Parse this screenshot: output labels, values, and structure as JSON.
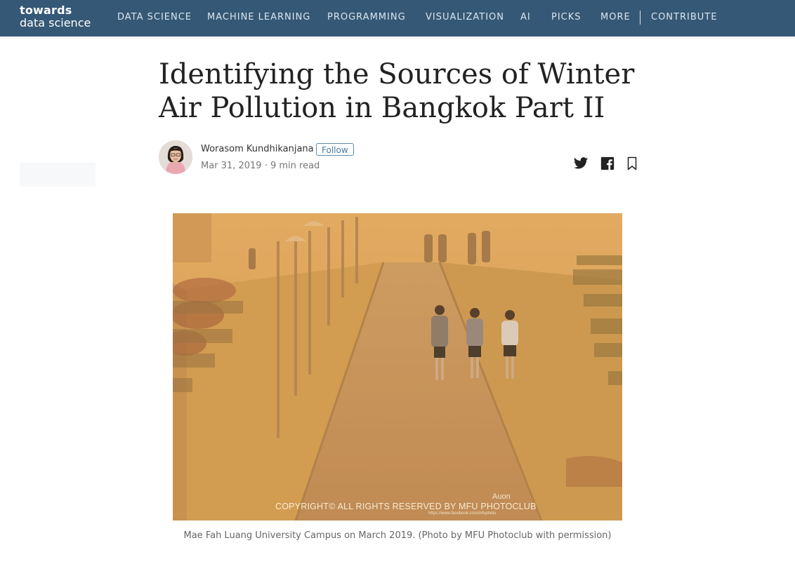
{
  "header": {
    "logo_line1": "towards",
    "logo_line2": "data science",
    "nav": [
      {
        "label": "DATA SCIENCE"
      },
      {
        "label": "MACHINE LEARNING"
      },
      {
        "label": "PROGRAMMING"
      },
      {
        "label": "VISUALIZATION"
      },
      {
        "label": "AI"
      },
      {
        "label": "PICKS"
      },
      {
        "label": "MORE"
      },
      {
        "label": "CONTRIBUTE"
      }
    ]
  },
  "article": {
    "title": "Identifying the Sources of Winter Air Pollution in Bangkok Part II",
    "author": {
      "name": "Worasom Kundhikanjana",
      "follow_label": "Follow"
    },
    "date": "Mar 31, 2019",
    "separator": "·",
    "read_time": "9 min read",
    "share_icons": [
      "twitter-icon",
      "facebook-icon",
      "bookmark-icon"
    ],
    "hero": {
      "watermark": "COPYRIGHT© ALL RIGHTS RESERVED BY MFU PHOTOCLUB",
      "signature": "Auon",
      "url": "https://www.facebook.com/mfuphoto",
      "caption": "Mae Fah Luang University Campus on March 2019. (Photo by MFU Photoclub with permission)"
    }
  },
  "colors": {
    "nav_background": "#355876",
    "nav_text": "#dbe6ef",
    "follow_accent": "#4a7aa2",
    "haze": "#d9a460"
  }
}
